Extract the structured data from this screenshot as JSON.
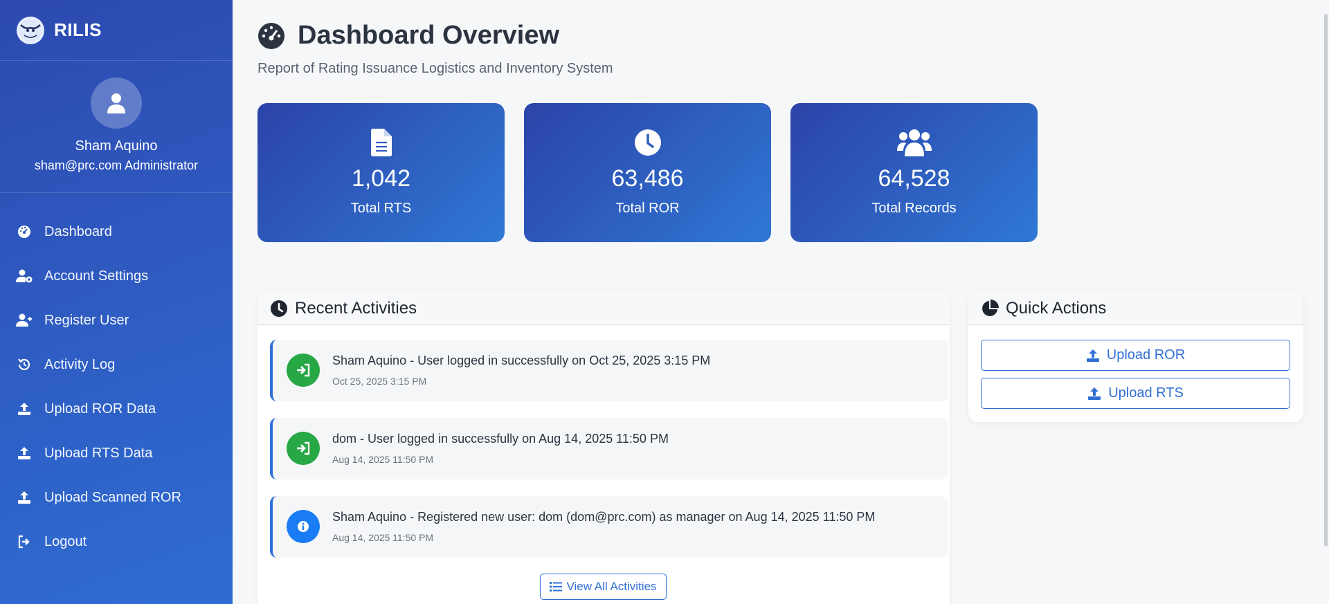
{
  "app": {
    "name": "RILIS"
  },
  "user": {
    "name": "Sham Aquino",
    "email_role": "sham@prc.com Administrator"
  },
  "sidebar": {
    "items": [
      {
        "label": "Dashboard",
        "icon": "gauge-icon"
      },
      {
        "label": "Account Settings",
        "icon": "user-gear-icon"
      },
      {
        "label": "Register User",
        "icon": "user-plus-icon"
      },
      {
        "label": "Activity Log",
        "icon": "history-icon"
      },
      {
        "label": "Upload ROR Data",
        "icon": "upload-icon"
      },
      {
        "label": "Upload RTS Data",
        "icon": "upload-icon"
      },
      {
        "label": "Upload Scanned ROR",
        "icon": "upload-icon"
      },
      {
        "label": "Logout",
        "icon": "logout-icon"
      }
    ]
  },
  "header": {
    "title": "Dashboard Overview",
    "subtitle": "Report of Rating Issuance Logistics and Inventory System"
  },
  "stats": [
    {
      "value": "1,042",
      "label": "Total RTS",
      "icon": "file-icon"
    },
    {
      "value": "63,486",
      "label": "Total ROR",
      "icon": "clock-icon"
    },
    {
      "value": "64,528",
      "label": "Total Records",
      "icon": "users-icon"
    }
  ],
  "recent": {
    "title": "Recent Activities",
    "items": [
      {
        "text": "Sham Aquino - User logged in successfully on Oct 25, 2025 3:15 PM",
        "time": "Oct 25, 2025 3:15 PM",
        "type": "login"
      },
      {
        "text": "dom - User logged in successfully on Aug 14, 2025 11:50 PM",
        "time": "Aug 14, 2025 11:50 PM",
        "type": "login"
      },
      {
        "text": "Sham Aquino - Registered new user: dom (dom@prc.com) as manager on Aug 14, 2025 11:50 PM",
        "time": "Aug 14, 2025 11:50 PM",
        "type": "info"
      }
    ],
    "view_all_label": "View All Activities"
  },
  "quick_actions": {
    "title": "Quick Actions",
    "upload_ror_label": "Upload ROR",
    "upload_rts_label": "Upload RTS"
  },
  "colors": {
    "accent": "#2f6fd6",
    "login_icon_bg": "#28a745",
    "info_icon_bg": "#1a7cf5",
    "sidebar_gradient_start": "#2d4ab0",
    "sidebar_gradient_end": "#2f6dd3"
  }
}
